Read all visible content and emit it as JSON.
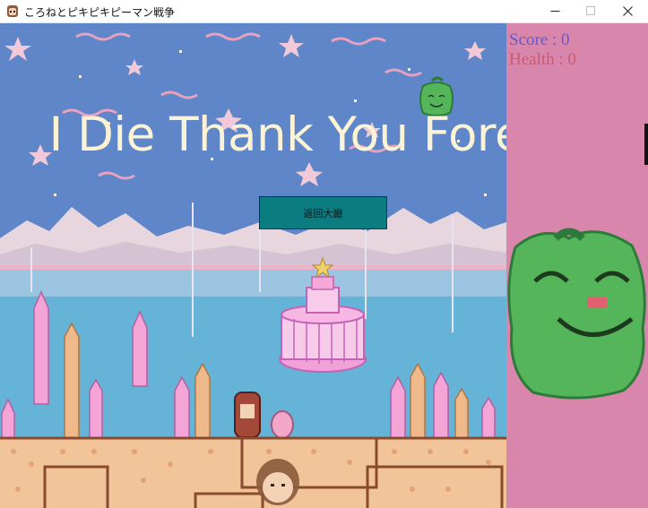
{
  "window": {
    "title": "ころねとピキピキピーマン戦争",
    "app_icon": "korone-face-icon",
    "controls": [
      "minimize-icon",
      "maximize-icon",
      "close-icon"
    ]
  },
  "game": {
    "banner": "I Die Thank You Forever",
    "lobby_button": "返回大廳"
  },
  "hud": {
    "score_label": "Score : 0",
    "health_label": "Health : 0"
  },
  "colors": {
    "sky": "#5f86c8",
    "sidebar": "#d986ad",
    "button": "#0b7c80",
    "banner_text": "#fbf3d3",
    "score_text": "#6b58c6",
    "health_text": "#cc5a6a",
    "pepper": "#54b55a"
  }
}
